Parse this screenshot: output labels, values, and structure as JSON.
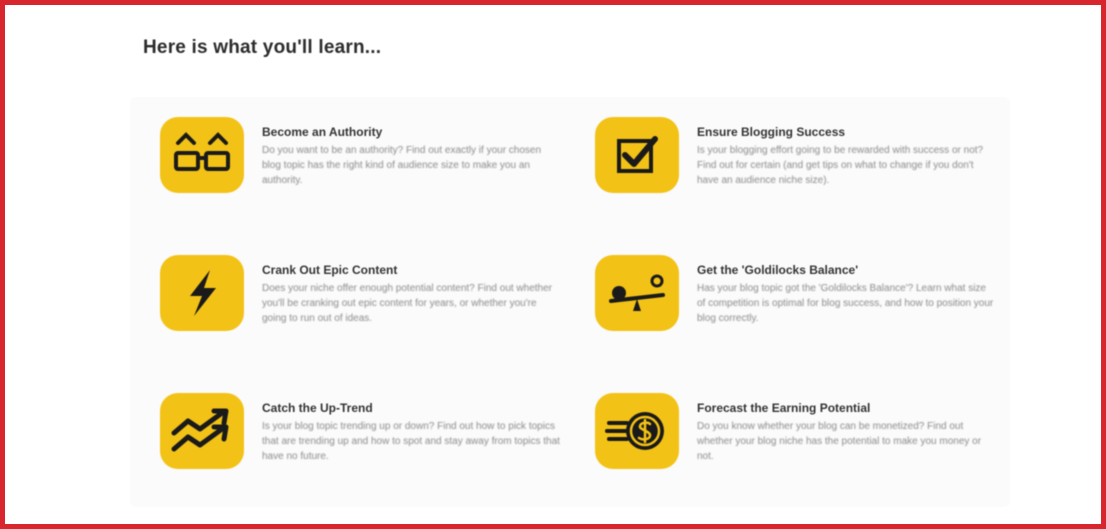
{
  "heading": "Here is what you'll learn...",
  "accent_color": "#f3c216",
  "border_color": "#d7262e",
  "features": [
    {
      "icon": "glasses-icon",
      "title": "Become an Authority",
      "description": "Do you want to be an authority? Find out exactly if your chosen blog topic has the right kind of audience size to make you an authority."
    },
    {
      "icon": "checkbox-icon",
      "title": "Ensure Blogging Success",
      "description": "Is your blogging effort going to be rewarded with success or not? Find out for certain (and get tips on what to change if you don't have an audience niche size)."
    },
    {
      "icon": "lightning-icon",
      "title": "Crank Out Epic Content",
      "description": "Does your niche offer enough potential content? Find out whether you'll be cranking out epic content for years, or whether you're going to run out of ideas."
    },
    {
      "icon": "seesaw-icon",
      "title": "Get the 'Goldilocks Balance'",
      "description": "Has your blog topic got the 'Goldilocks Balance'? Learn what size of competition is optimal for blog success, and how to position your blog correctly."
    },
    {
      "icon": "trend-arrows-icon",
      "title": "Catch the Up-Trend",
      "description": "Is your blog topic trending up or down? Find out how to pick topics that are trending up and how to spot and stay away from topics that have no future."
    },
    {
      "icon": "coin-icon",
      "title": "Forecast the Earning Potential",
      "description": "Do you know whether your blog can be monetized? Find out whether your blog niche has the potential to make you money or not."
    }
  ]
}
